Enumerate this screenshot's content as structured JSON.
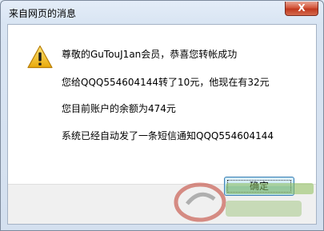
{
  "window": {
    "title": "来自网页的消息",
    "close_symbol": "X"
  },
  "dialog": {
    "icon": "warning-icon",
    "messages": [
      "尊敬的GuTouJ1an会员，恭喜您转帐成功",
      "您给QQQ554604144转了10元，他现在有32元",
      "您目前账户的余额为474元",
      "系统已经自动发了一条短信通知QQQ554604144"
    ],
    "ok_button": "确定"
  },
  "colors": {
    "close_button": "#c7432a",
    "ok_button_border": "#3c7fb1",
    "warning_fill": "#f5c518"
  }
}
